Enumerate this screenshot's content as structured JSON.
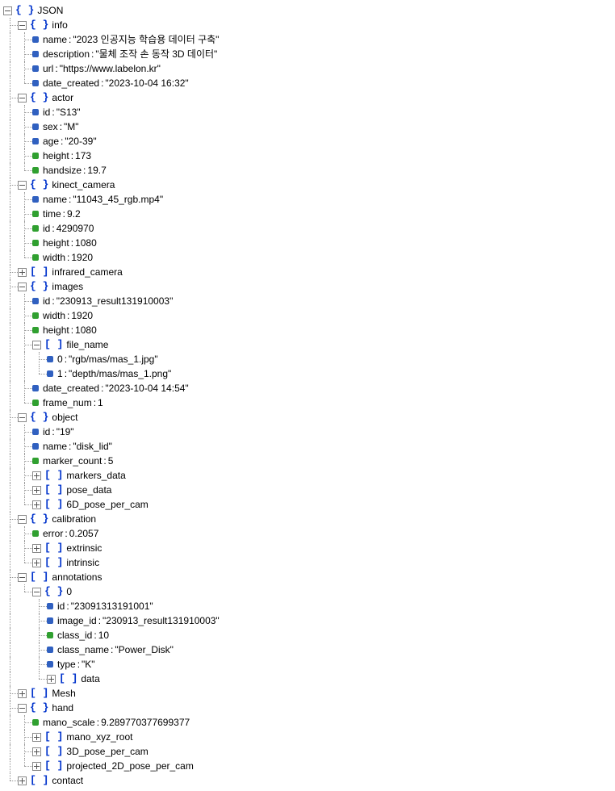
{
  "root": "JSON",
  "info": {
    "label": "info",
    "name_k": "name",
    "name_v": "\"2023 인공지능 학습용 데이터 구축\"",
    "description_k": "description",
    "description_v": "\"물체 조작 손 동작 3D 데이터\"",
    "url_k": "url",
    "url_v": "\"https://www.labelon.kr\"",
    "date_k": "date_created",
    "date_v": "\"2023-10-04 16:32\""
  },
  "actor": {
    "label": "actor",
    "id_k": "id",
    "id_v": "\"S13\"",
    "sex_k": "sex",
    "sex_v": "\"M\"",
    "age_k": "age",
    "age_v": "\"20-39\"",
    "height_k": "height",
    "height_v": "173",
    "handsize_k": "handsize",
    "handsize_v": "19.7"
  },
  "kinect": {
    "label": "kinect_camera",
    "name_k": "name",
    "name_v": "\"11043_45_rgb.mp4\"",
    "time_k": "time",
    "time_v": "9.2",
    "id_k": "id",
    "id_v": "4290970",
    "height_k": "height",
    "height_v": "1080",
    "width_k": "width",
    "width_v": "1920"
  },
  "infrared": {
    "label": "infrared_camera"
  },
  "images": {
    "label": "images",
    "id_k": "id",
    "id_v": "\"230913_result131910003\"",
    "width_k": "width",
    "width_v": "1920",
    "height_k": "height",
    "height_v": "1080",
    "file_name": {
      "label": "file_name",
      "k0": "0",
      "v0": "\"rgb/mas/mas_1.jpg\"",
      "k1": "1",
      "v1": "\"depth/mas/mas_1.png\""
    },
    "date_k": "date_created",
    "date_v": "\"2023-10-04 14:54\"",
    "frame_k": "frame_num",
    "frame_v": "1"
  },
  "object": {
    "label": "object",
    "id_k": "id",
    "id_v": "\"19\"",
    "name_k": "name",
    "name_v": "\"disk_lid\"",
    "marker_k": "marker_count",
    "marker_v": "5",
    "markers_data": "markers_data",
    "pose_data": "pose_data",
    "six_pose": "6D_pose_per_cam"
  },
  "calibration": {
    "label": "calibration",
    "error_k": "error",
    "error_v": "0.2057",
    "extrinsic": "extrinsic",
    "intrinsic": "intrinsic"
  },
  "annotations": {
    "label": "annotations",
    "zero": "0",
    "id_k": "id",
    "id_v": "\"23091313191001\"",
    "imgid_k": "image_id",
    "imgid_v": "\"230913_result131910003\"",
    "clsid_k": "class_id",
    "clsid_v": "10",
    "clsname_k": "class_name",
    "clsname_v": "\"Power_Disk\"",
    "type_k": "type",
    "type_v": "\"K\"",
    "data": "data"
  },
  "mesh": "Mesh",
  "hand": {
    "label": "hand",
    "mano_k": "mano_scale",
    "mano_v": "9.289770377699377",
    "mano_xyz": "mano_xyz_root",
    "pose3d": "3D_pose_per_cam",
    "proj2d": "projected_2D_pose_per_cam"
  },
  "contact": "contact"
}
